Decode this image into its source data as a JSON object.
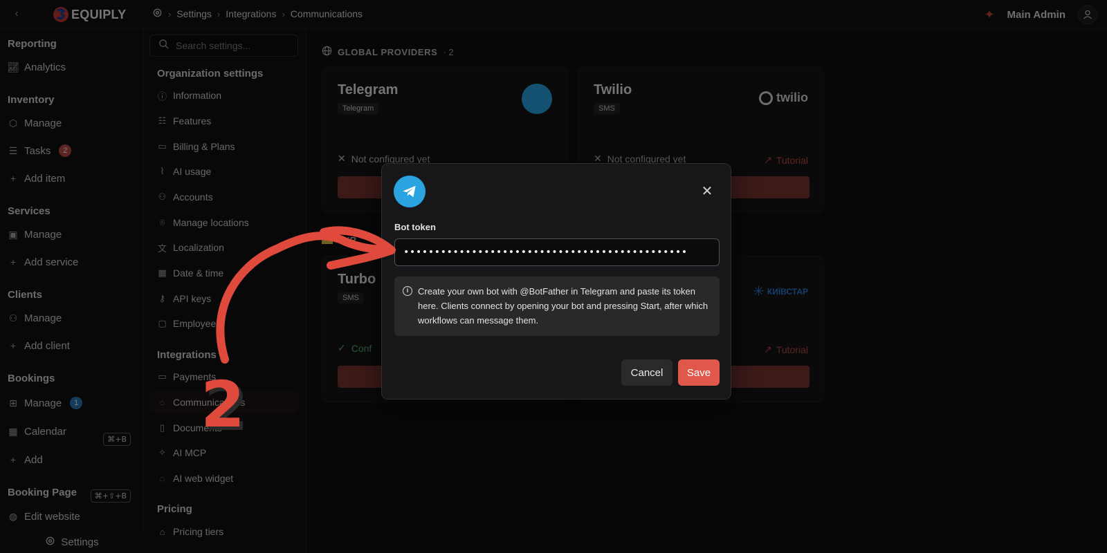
{
  "topbar": {
    "logo_text": "EQUIPLY",
    "breadcrumbs": [
      "Settings",
      "Integrations",
      "Communications"
    ],
    "admin_name": "Main Admin"
  },
  "sidebar": {
    "sections": [
      {
        "title": "Reporting",
        "items": [
          {
            "label": "Analytics",
            "icon": "chart-icon"
          }
        ]
      },
      {
        "title": "Inventory",
        "items": [
          {
            "label": "Manage",
            "icon": "box-icon"
          },
          {
            "label": "Tasks",
            "icon": "list-icon",
            "badge": "2"
          },
          {
            "label": "Add item",
            "icon": "plus-icon"
          }
        ]
      },
      {
        "title": "Services",
        "items": [
          {
            "label": "Manage",
            "icon": "briefcase-icon"
          },
          {
            "label": "Add service",
            "icon": "plus-icon"
          }
        ]
      },
      {
        "title": "Clients",
        "items": [
          {
            "label": "Manage",
            "icon": "users-icon"
          },
          {
            "label": "Add client",
            "icon": "plus-icon"
          }
        ]
      },
      {
        "title": "Bookings",
        "items": [
          {
            "label": "Manage",
            "icon": "grid-icon",
            "badge": "1",
            "shortcut": "⌘+B"
          },
          {
            "label": "Calendar",
            "icon": "calendar-icon"
          },
          {
            "label": "Add",
            "icon": "plus-icon",
            "shortcut": "⌘+⇧+B"
          }
        ]
      },
      {
        "title": "Booking Page",
        "items": [
          {
            "label": "Edit website",
            "icon": "globe-icon"
          }
        ]
      }
    ],
    "footer_label": "Settings"
  },
  "settings_nav": {
    "search_placeholder": "Search settings...",
    "org_title": "Organization settings",
    "org_items": [
      "Information",
      "Features",
      "Billing & Plans",
      "AI usage",
      "Accounts",
      "Manage locations",
      "Localization",
      "Date & time",
      "API keys",
      "Employees"
    ],
    "integrations_title": "Integrations",
    "integrations_items": [
      "Payments",
      "Communications",
      "Documents",
      "AI MCP",
      "AI web widget"
    ],
    "pricing_title": "Pricing",
    "pricing_items": [
      "Pricing tiers"
    ]
  },
  "main": {
    "global_providers_label": "GLOBAL PROVIDERS",
    "global_providers_count": "· 2",
    "cards": [
      {
        "title": "Telegram",
        "tag": "Telegram",
        "status": "Not configured yet"
      },
      {
        "title": "Twilio",
        "tag": "SMS",
        "status": "Not configured yet",
        "tutorial": "Tutorial",
        "logo_text": "twilio"
      },
      {
        "title": "Turbo",
        "tag": "SMS",
        "status": "Conf",
        "ua_label": "UKR"
      },
      {
        "title": "",
        "tag": "",
        "tutorial": "Tutorial",
        "logo_text": "КИЇВСТАР"
      }
    ]
  },
  "modal": {
    "field_label": "Bot token",
    "token_value": "••••••••••••••••••••••••••••••••••••••••••••••",
    "info_text": "Create your own bot with @BotFather in Telegram and paste its token here. Clients connect by opening your bot and pressing Start, after which workflows can message them.",
    "cancel_label": "Cancel",
    "save_label": "Save"
  },
  "annotation": {
    "step_number": "2"
  },
  "colors": {
    "accent": "#e0584b",
    "telegram_blue": "#2aa3e0",
    "success": "#58b06a",
    "annotation": "#e04a3d"
  }
}
